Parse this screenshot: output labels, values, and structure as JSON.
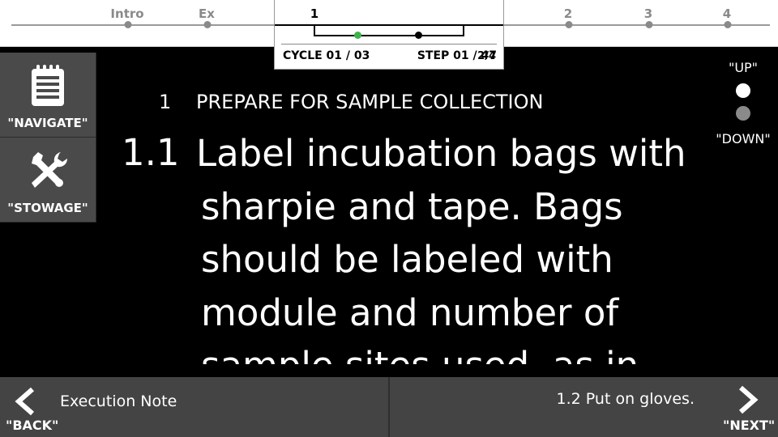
{
  "progress": {
    "sections": [
      {
        "label": "Intro",
        "active": false
      },
      {
        "label": "Ex",
        "active": false
      },
      {
        "label": "1",
        "active": true
      },
      {
        "label": "2",
        "active": false
      },
      {
        "label": "3",
        "active": false
      },
      {
        "label": "4",
        "active": false
      }
    ],
    "cycle_label": "CYCLE 01 / 03",
    "step_label": "STEP 01 / 47",
    "step_overlay": "2/4"
  },
  "sidebar": {
    "navigate_label": "\"NAVIGATE\"",
    "stowage_label": "\"STOWAGE\"",
    "navigate_icon": "notepad-icon",
    "stowage_icon": "tools-icon"
  },
  "scroll": {
    "up_label": "\"UP\"",
    "down_label": "\"DOWN\""
  },
  "procedure": {
    "section_number": "1",
    "section_title": "PREPARE FOR SAMPLE COLLECTION",
    "step_number": "1.1",
    "step_text_first": "Label incubation bags with",
    "step_text_rest": "sharpie and tape. Bags should be labeled with module and number of sample sites used, as in"
  },
  "footer": {
    "back_label": "\"BACK\"",
    "next_label": "\"NEXT\"",
    "previous_text": "Execution Note",
    "next_text": "1.2 Put on gloves."
  },
  "colors": {
    "accent_green": "#3cb44b",
    "panel_gray": "#444444",
    "side_button_gray": "#4a4a4a"
  }
}
